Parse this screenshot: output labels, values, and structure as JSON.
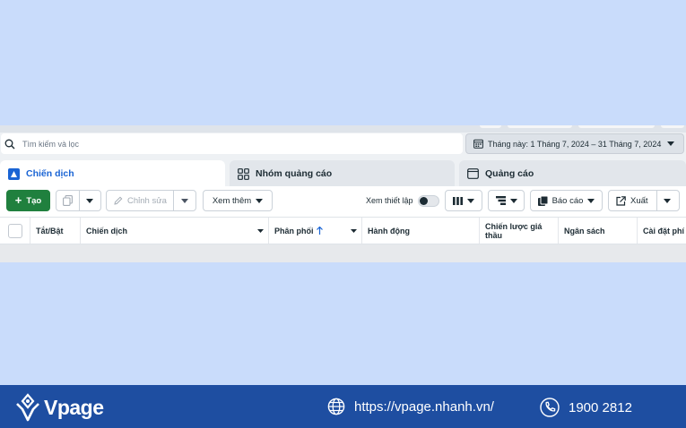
{
  "search": {
    "placeholder": "Tìm kiếm và lọc"
  },
  "date_range": {
    "label": "Tháng này: 1 Tháng 7, 2024 – 31 Tháng 7, 2024"
  },
  "tabs": [
    {
      "label": "Chiến dịch",
      "active": true
    },
    {
      "label": "Nhóm quảng cáo",
      "active": false
    },
    {
      "label": "Quảng cáo",
      "active": false
    }
  ],
  "toolbar": {
    "create_label": "Tạo",
    "edit_label": "Chỉnh sửa",
    "more_label": "Xem thêm",
    "setup_view_label": "Xem thiết lập",
    "reports_label": "Báo cáo",
    "export_label": "Xuất"
  },
  "table": {
    "columns": [
      "Tắt/Bật",
      "Chiến dịch",
      "Phân phối",
      "Hành động",
      "Chiến lược giá thầu",
      "Ngân sách",
      "Cài đặt phí"
    ]
  },
  "footer": {
    "brand": "Vpage",
    "website": "https://vpage.nhanh.vn/",
    "hotline": "1900 2812"
  },
  "colors": {
    "page_bg": "#c9dcfb",
    "accent_blue": "#1a64d4",
    "create_green": "#20803e",
    "footer_bg": "#1e4ea1"
  }
}
